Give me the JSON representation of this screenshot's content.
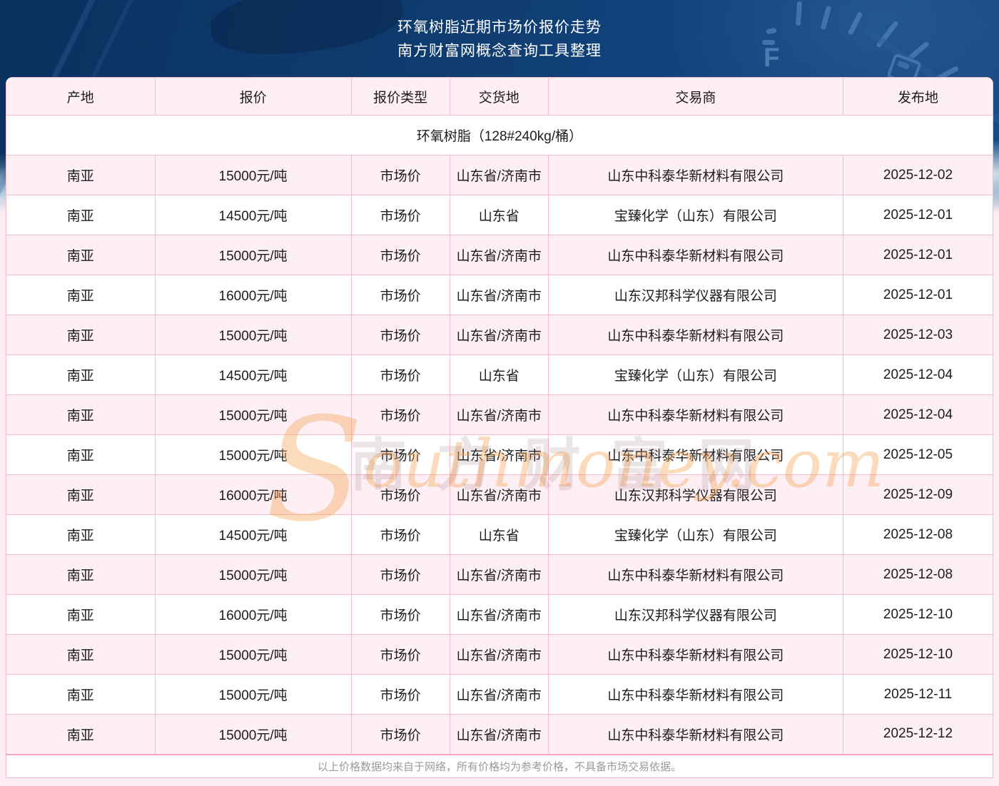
{
  "page_title": {
    "line1": "环氧树脂近期市场价报价走势",
    "line2": "南方财富网概念查询工具整理"
  },
  "background": {
    "gauge_f_label": "F"
  },
  "table": {
    "columns": [
      "产地",
      "报价",
      "报价类型",
      "交货地",
      "交易商",
      "发布地"
    ],
    "product_group_label": "环氧树脂（128#240kg/桶）",
    "rows": [
      {
        "origin": "南亚",
        "price": "15000元/吨",
        "price_type": "市场价",
        "delivery": "山东省/济南市",
        "trader": "山东中科泰华新材料有限公司",
        "date": "2025-12-02"
      },
      {
        "origin": "南亚",
        "price": "14500元/吨",
        "price_type": "市场价",
        "delivery": "山东省",
        "trader": "宝臻化学（山东）有限公司",
        "date": "2025-12-01"
      },
      {
        "origin": "南亚",
        "price": "15000元/吨",
        "price_type": "市场价",
        "delivery": "山东省/济南市",
        "trader": "山东中科泰华新材料有限公司",
        "date": "2025-12-01"
      },
      {
        "origin": "南亚",
        "price": "16000元/吨",
        "price_type": "市场价",
        "delivery": "山东省/济南市",
        "trader": "山东汉邦科学仪器有限公司",
        "date": "2025-12-01"
      },
      {
        "origin": "南亚",
        "price": "15000元/吨",
        "price_type": "市场价",
        "delivery": "山东省/济南市",
        "trader": "山东中科泰华新材料有限公司",
        "date": "2025-12-03"
      },
      {
        "origin": "南亚",
        "price": "14500元/吨",
        "price_type": "市场价",
        "delivery": "山东省",
        "trader": "宝臻化学（山东）有限公司",
        "date": "2025-12-04"
      },
      {
        "origin": "南亚",
        "price": "15000元/吨",
        "price_type": "市场价",
        "delivery": "山东省/济南市",
        "trader": "山东中科泰华新材料有限公司",
        "date": "2025-12-04"
      },
      {
        "origin": "南亚",
        "price": "15000元/吨",
        "price_type": "市场价",
        "delivery": "山东省/济南市",
        "trader": "山东中科泰华新材料有限公司",
        "date": "2025-12-05"
      },
      {
        "origin": "南亚",
        "price": "16000元/吨",
        "price_type": "市场价",
        "delivery": "山东省/济南市",
        "trader": "山东汉邦科学仪器有限公司",
        "date": "2025-12-09"
      },
      {
        "origin": "南亚",
        "price": "14500元/吨",
        "price_type": "市场价",
        "delivery": "山东省",
        "trader": "宝臻化学（山东）有限公司",
        "date": "2025-12-08"
      },
      {
        "origin": "南亚",
        "price": "15000元/吨",
        "price_type": "市场价",
        "delivery": "山东省/济南市",
        "trader": "山东中科泰华新材料有限公司",
        "date": "2025-12-08"
      },
      {
        "origin": "南亚",
        "price": "16000元/吨",
        "price_type": "市场价",
        "delivery": "山东省/济南市",
        "trader": "山东汉邦科学仪器有限公司",
        "date": "2025-12-10"
      },
      {
        "origin": "南亚",
        "price": "15000元/吨",
        "price_type": "市场价",
        "delivery": "山东省/济南市",
        "trader": "山东中科泰华新材料有限公司",
        "date": "2025-12-10"
      },
      {
        "origin": "南亚",
        "price": "15000元/吨",
        "price_type": "市场价",
        "delivery": "山东省/济南市",
        "trader": "山东中科泰华新材料有限公司",
        "date": "2025-12-11"
      },
      {
        "origin": "南亚",
        "price": "15000元/吨",
        "price_type": "市场价",
        "delivery": "山东省/济南市",
        "trader": "山东中科泰华新材料有限公司",
        "date": "2025-12-12"
      }
    ],
    "footer_note": "以上价格数据均来自于网络，所有价格均为参考价格，不具备市场交易依据。"
  },
  "watermark": {
    "cn": "南方财富网",
    "en_initial": "S",
    "en_rest": "outhmoney.com"
  },
  "colors": {
    "header_navy": "#0e3a6c",
    "row_pink": "#fdeff4",
    "row_white": "#ffffff",
    "border_pink": "#f8bac7",
    "page_pink": "#fdedf2",
    "watermark_orange": "#f6a658"
  }
}
